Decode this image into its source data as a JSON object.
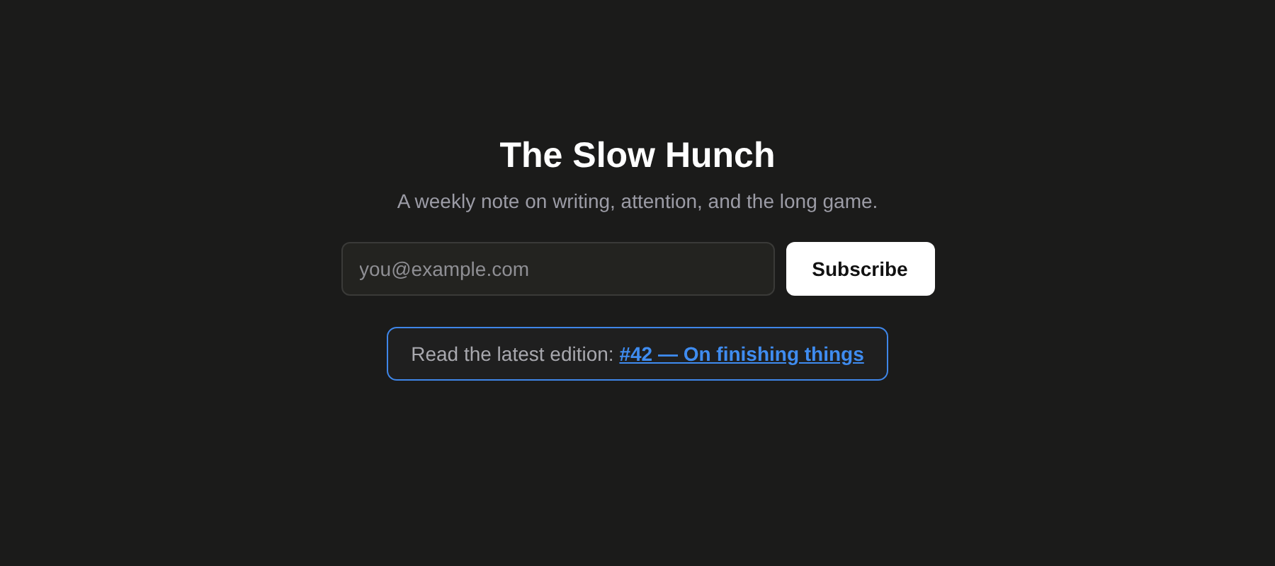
{
  "title": "The Slow Hunch",
  "subtitle": "A weekly note on writing, attention, and the long game.",
  "email_field": {
    "placeholder": "you@example.com"
  },
  "subscribe_button": "Subscribe",
  "latest": {
    "text": "Read the latest edition:",
    "link": "#42 — On finishing things"
  }
}
